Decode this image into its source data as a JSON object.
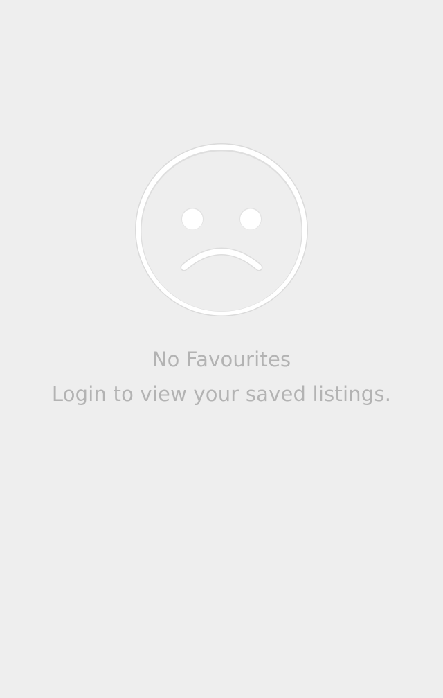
{
  "empty_state": {
    "icon": "sad-face-icon",
    "title": "No Favourites",
    "message": "Login to view your saved listings."
  },
  "colors": {
    "background": "#eeeeee",
    "text": "#b3b3b3",
    "icon_fill": "#ffffff",
    "icon_stroke": "#dddddd"
  }
}
